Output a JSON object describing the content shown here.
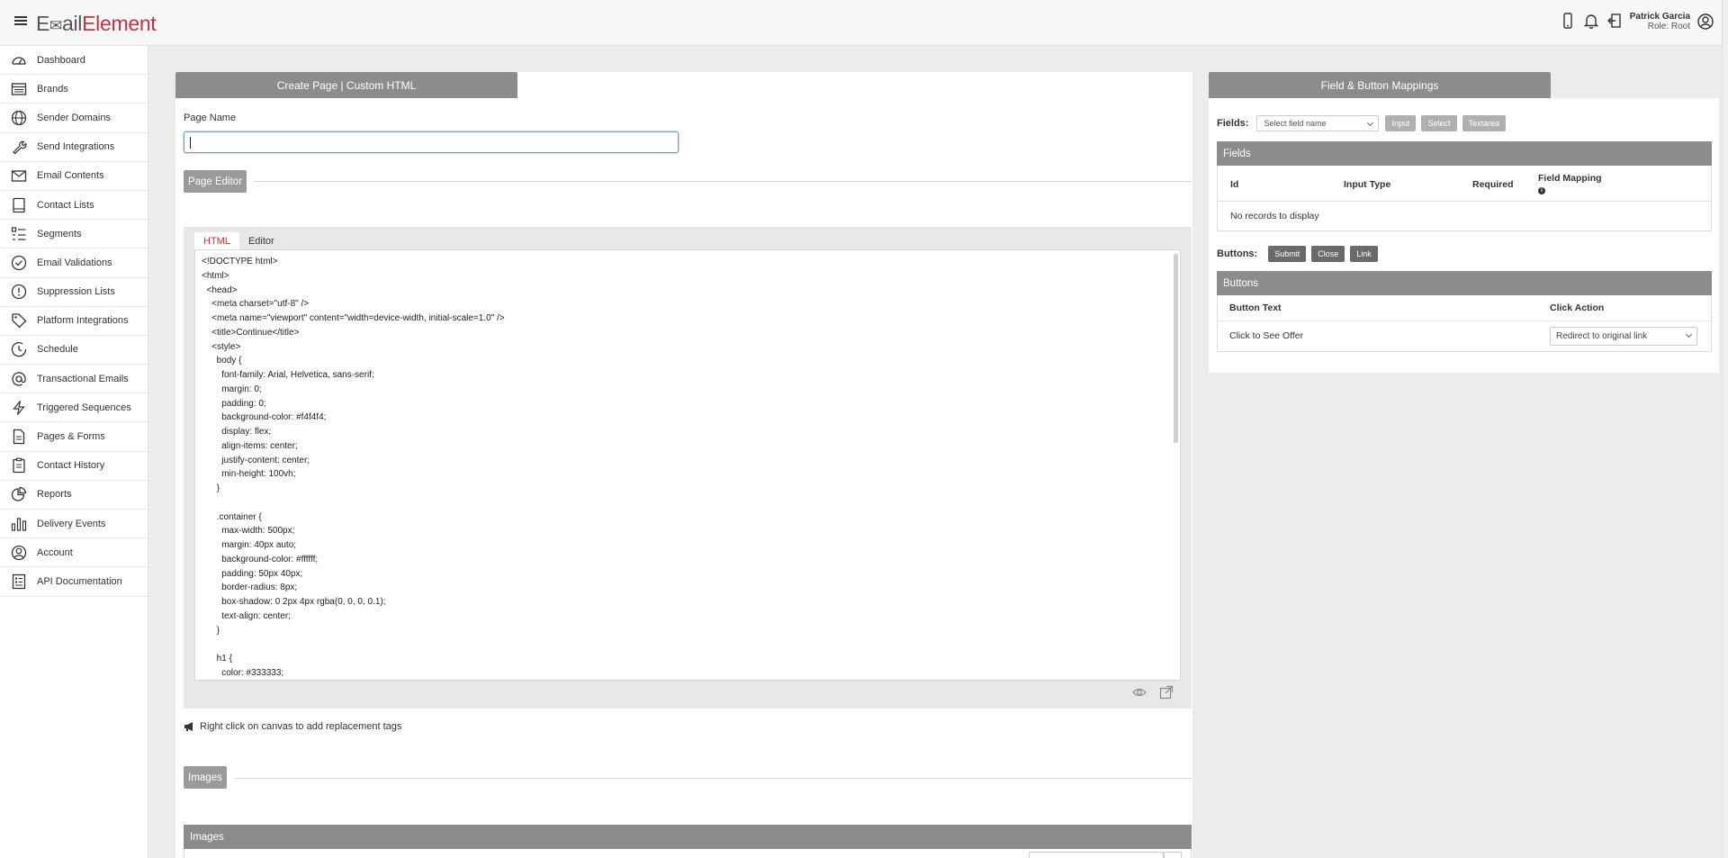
{
  "app": {
    "logo_part1": "E",
    "logo_mark": "✉",
    "logo_part2": "ail",
    "logo_part3": "Element",
    "user_name": "Patrick Garcia",
    "user_role": "Role: Root"
  },
  "sidebar": {
    "items": [
      {
        "label": "Dashboard",
        "icon": "gauge-icon"
      },
      {
        "label": "Brands",
        "icon": "list-box-icon"
      },
      {
        "label": "Sender Domains",
        "icon": "globe-icon"
      },
      {
        "label": "Send Integrations",
        "icon": "wrench-icon"
      },
      {
        "label": "Email Contents",
        "icon": "envelope-icon"
      },
      {
        "label": "Contact Lists",
        "icon": "book-icon"
      },
      {
        "label": "Segments",
        "icon": "segments-icon"
      },
      {
        "label": "Email Validations",
        "icon": "check-circle-icon"
      },
      {
        "label": "Suppression Lists",
        "icon": "exclamation-circle-icon"
      },
      {
        "label": "Platform Integrations",
        "icon": "tag-icon"
      },
      {
        "label": "Schedule",
        "icon": "clock-icon"
      },
      {
        "label": "Transactional Emails",
        "icon": "at-icon"
      },
      {
        "label": "Triggered Sequences",
        "icon": "bolt-icon"
      },
      {
        "label": "Pages & Forms",
        "icon": "file-icon"
      },
      {
        "label": "Contact History",
        "icon": "clipboard-icon"
      },
      {
        "label": "Reports",
        "icon": "pie-chart-icon"
      },
      {
        "label": "Delivery Events",
        "icon": "bar-chart-icon"
      },
      {
        "label": "Account",
        "icon": "user-circle-icon"
      },
      {
        "label": "API Documentation",
        "icon": "document-list-icon"
      }
    ]
  },
  "main": {
    "header_title": "Create Page | Custom HTML",
    "page_name_label": "Page Name",
    "page_name_value": "",
    "page_editor_label": "Page Editor",
    "tab_html": "HTML",
    "tab_editor": "Editor",
    "code_text": "<!DOCTYPE html>\n<html>\n  <head>\n    <meta charset=\"utf-8\" />\n    <meta name=\"viewport\" content=\"width=device-width, initial-scale=1.0\" />\n    <title>Continue</title>\n    <style>\n      body {\n        font-family: Arial, Helvetica, sans-serif;\n        margin: 0;\n        padding: 0;\n        background-color: #f4f4f4;\n        display: flex;\n        align-items: center;\n        justify-content: center;\n        min-height: 100vh;\n      }\n\n      .container {\n        max-width: 500px;\n        margin: 40px auto;\n        background-color: #ffffff;\n        padding: 50px 40px;\n        border-radius: 8px;\n        box-shadow: 0 2px 4px rgba(0, 0, 0, 0.1);\n        text-align: center;\n      }\n\n      h1 {\n        color: #333333;",
    "hint_text": "Right click on canvas to add replacement tags",
    "images_button": "Images",
    "images_panel_title": "Images"
  },
  "mappings": {
    "header_title": "Field & Button Mappings",
    "fields_label": "Fields:",
    "select_placeholder": "Select field name",
    "btn_input": "Input",
    "btn_select": "Select",
    "btn_textarea": "Textarea",
    "fields_panel_title": "Fields",
    "fields_columns": [
      "Id",
      "Input Type",
      "Required",
      "Field Mapping"
    ],
    "fields_empty": "No records to display",
    "buttons_label": "Buttons:",
    "btn_submit": "Submit",
    "btn_close": "Close",
    "btn_link": "Link",
    "buttons_panel_title": "Buttons",
    "buttons_columns": [
      "Button Text",
      "Click Action"
    ],
    "buttons_rows": [
      {
        "text": "Click to See Offer",
        "action": "Redirect to original link"
      }
    ]
  },
  "colors": {
    "brand_red": "#c8323b",
    "header_gray": "#8c8c8c",
    "background": "#ececec"
  }
}
